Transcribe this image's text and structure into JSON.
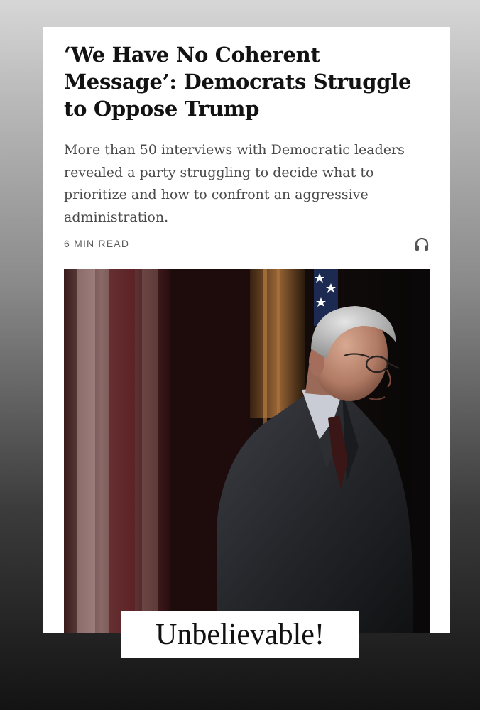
{
  "article": {
    "headline": "‘We Have No Coherent Message’: Democrats Struggle to Oppose Trump",
    "summary": "More than 50 interviews with Democratic leaders revealed a party struggling to decide what to prioritize and how to confront an aggressive administration.",
    "read_time": "6 MIN READ",
    "audio_icon": "headphones-icon",
    "photo_icon": "photo-image"
  },
  "overlay": {
    "caption": "Unbelievable!"
  },
  "colors": {
    "background_top": "#d7d7d7",
    "background_bottom": "#131313",
    "card": "#ffffff",
    "headline": "#121212",
    "summary": "#4a4a4a"
  }
}
